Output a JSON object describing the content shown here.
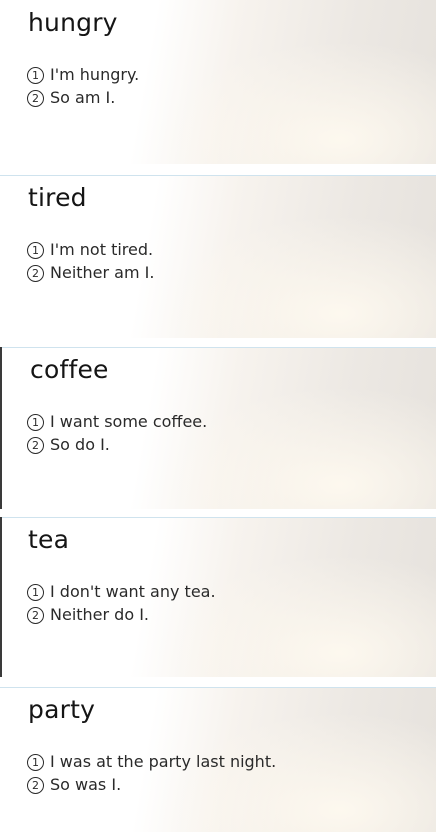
{
  "cards": [
    {
      "title": "hungry",
      "line1_num": "1",
      "line1": "I'm hungry.",
      "line2_num": "2",
      "line2": "So am I."
    },
    {
      "title": "tired",
      "line1_num": "1",
      "line1": "I'm not tired.",
      "line2_num": "2",
      "line2": "Neither am I."
    },
    {
      "title": "coffee",
      "line1_num": "1",
      "line1": "I want some coffee.",
      "line2_num": "2",
      "line2": "So do I."
    },
    {
      "title": "tea",
      "line1_num": "1",
      "line1": "I don't want any tea.",
      "line2_num": "2",
      "line2": "Neither do I."
    },
    {
      "title": "party",
      "line1_num": "1",
      "line1": "I was at the party last night.",
      "line2_num": "2",
      "line2": "So was I."
    }
  ]
}
